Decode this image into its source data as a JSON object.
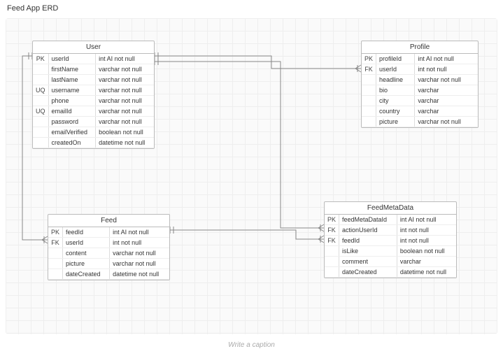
{
  "page": {
    "title": "Feed App ERD",
    "caption_placeholder": "Write a caption"
  },
  "entities": {
    "user": {
      "name": "User",
      "fields": [
        {
          "key": "PK",
          "name": "userId",
          "type": "int AI not null"
        },
        {
          "key": "",
          "name": "firstName",
          "type": "varchar not null"
        },
        {
          "key": "",
          "name": "lastName",
          "type": "varchar not null"
        },
        {
          "key": "UQ",
          "name": "username",
          "type": "varchar not null"
        },
        {
          "key": "",
          "name": "phone",
          "type": "varchar not null"
        },
        {
          "key": "UQ",
          "name": "emailId",
          "type": "varchar not null"
        },
        {
          "key": "",
          "name": "password",
          "type": "varchar not null"
        },
        {
          "key": "",
          "name": "emailVerified",
          "type": "boolean not null"
        },
        {
          "key": "",
          "name": "createdOn",
          "type": "datetime not null"
        }
      ]
    },
    "profile": {
      "name": "Profile",
      "fields": [
        {
          "key": "PK",
          "name": "profileId",
          "type": "int AI not null"
        },
        {
          "key": "FK",
          "name": "userId",
          "type": "int not null"
        },
        {
          "key": "",
          "name": "headline",
          "type": "varchar not null"
        },
        {
          "key": "",
          "name": "bio",
          "type": "varchar"
        },
        {
          "key": "",
          "name": "city",
          "type": "varchar"
        },
        {
          "key": "",
          "name": "country",
          "type": "varchar"
        },
        {
          "key": "",
          "name": "picture",
          "type": "varchar not null"
        }
      ]
    },
    "feed": {
      "name": "Feed",
      "fields": [
        {
          "key": "PK",
          "name": "feedId",
          "type": "int AI not null"
        },
        {
          "key": "FK",
          "name": "userId",
          "type": "int not null"
        },
        {
          "key": "",
          "name": "content",
          "type": "varchar not null"
        },
        {
          "key": "",
          "name": "picture",
          "type": "varchar not null"
        },
        {
          "key": "",
          "name": "dateCreated",
          "type": "datetime not null"
        }
      ]
    },
    "feedmetadata": {
      "name": "FeedMetaData",
      "fields": [
        {
          "key": "PK",
          "name": "feedMetaDataId",
          "type": "int AI not null"
        },
        {
          "key": "FK",
          "name": "actionUserId",
          "type": "int not null"
        },
        {
          "key": "FK",
          "name": "feedId",
          "type": "int not null"
        },
        {
          "key": "",
          "name": "isLike",
          "type": "boolean not null"
        },
        {
          "key": "",
          "name": "comment",
          "type": "varchar"
        },
        {
          "key": "",
          "name": "dateCreated",
          "type": "datetime not null"
        }
      ]
    }
  }
}
